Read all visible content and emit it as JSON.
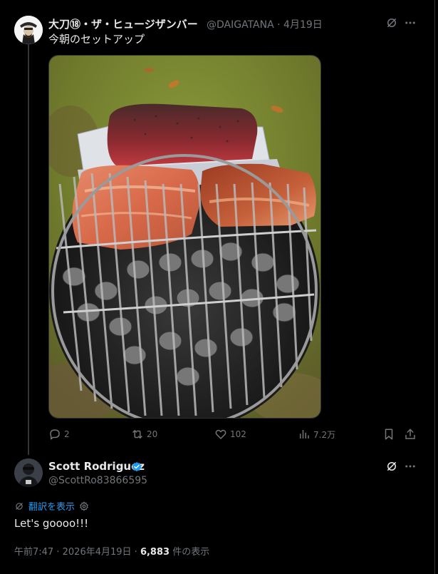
{
  "tweet1": {
    "display_name": "大刀⑱・ザ・ヒュージザンバー",
    "handle": "@DAIGATANA",
    "sep": "·",
    "date": "4月19日",
    "text": "今朝のセットアップ",
    "actions": {
      "reply_count": "2",
      "repost_count": "20",
      "like_count": "102",
      "view_count": "7.2万"
    }
  },
  "tweet2": {
    "display_name": "Scott Rodriguez",
    "handle": "@ScottRo83866595",
    "translate_label": "翻訳を表示",
    "text": "Let's goooo!!!",
    "time": "午前7:47",
    "date": "2026年4月19日",
    "views": "6,883",
    "views_suffix": "件の表示",
    "sep": "·"
  },
  "colors": {
    "background": "#000000",
    "text": "#e7e9ea",
    "muted": "#71767b",
    "link": "#1d9bf0",
    "border": "#2f3336"
  },
  "icons": [
    "grok-icon",
    "more-icon",
    "reply-icon",
    "repost-icon",
    "like-icon",
    "views-icon",
    "bookmark-icon",
    "share-icon",
    "verified-icon",
    "translate-icon",
    "settings-icon"
  ]
}
